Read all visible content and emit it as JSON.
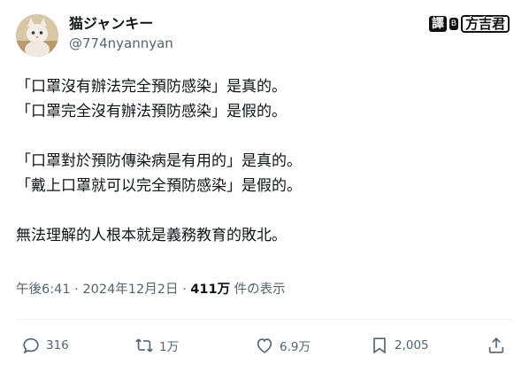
{
  "user": {
    "display_name": "猫ジャンキー",
    "handle": "@774nyannyan",
    "avatar": "cat-avatar"
  },
  "watermark": {
    "box_label": "譯",
    "dot_label": "B",
    "name": "方吉君"
  },
  "tweet": {
    "lines": [
      "「口罩沒有辦法完全預防感染」是真的。",
      "「口罩完全沒有辦法預防感染」是假的。",
      "",
      "「口罩對於預防傳染病是有用的」是真的。",
      "「戴上口罩就可以完全預防感染」是假的。",
      "",
      "無法理解的人根本就是義務教育的敗北。"
    ]
  },
  "meta": {
    "time": "午後6:41",
    "separator": "·",
    "date": "2024年12月2日",
    "separator2": "·",
    "views_count": "411万",
    "views_label": " 件の表示"
  },
  "actions": {
    "reply": {
      "icon": "reply-icon",
      "count": "316"
    },
    "retweet": {
      "icon": "retweet-icon",
      "count": "1万"
    },
    "like": {
      "icon": "heart-icon",
      "count": "6.9万"
    },
    "bookmark": {
      "icon": "bookmark-icon",
      "count": "2,005"
    },
    "share": {
      "icon": "share-icon"
    }
  }
}
